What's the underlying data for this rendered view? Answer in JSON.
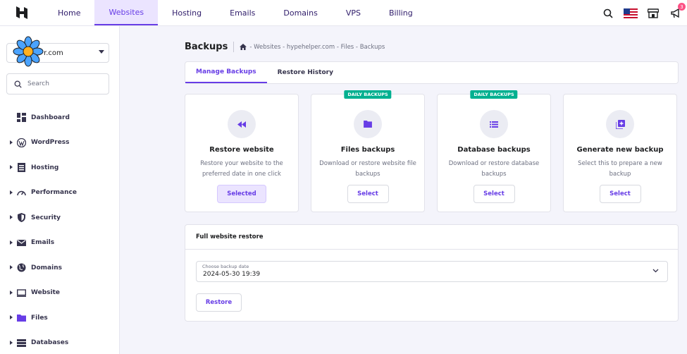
{
  "nav": {
    "items": [
      {
        "label": "Home",
        "active": false
      },
      {
        "label": "Websites",
        "active": true
      },
      {
        "label": "Hosting",
        "active": false
      },
      {
        "label": "Emails",
        "active": false
      },
      {
        "label": "Domains",
        "active": false
      },
      {
        "label": "VPS",
        "active": false
      },
      {
        "label": "Billing",
        "active": false
      }
    ],
    "notification_count": "3"
  },
  "sidebar": {
    "site_value": "r.com",
    "search_placeholder": "Search",
    "items": [
      {
        "label": "Dashboard",
        "icon": "dashboard-icon"
      },
      {
        "label": "WordPress",
        "icon": "wordpress-icon"
      },
      {
        "label": "Hosting",
        "icon": "hosting-icon"
      },
      {
        "label": "Performance",
        "icon": "gauge-icon"
      },
      {
        "label": "Security",
        "icon": "shield-icon"
      },
      {
        "label": "Emails",
        "icon": "mail-icon"
      },
      {
        "label": "Domains",
        "icon": "globe-icon"
      },
      {
        "label": "Website",
        "icon": "monitor-icon"
      },
      {
        "label": "Files",
        "icon": "folder-icon"
      },
      {
        "label": "Databases",
        "icon": "database-icon"
      }
    ]
  },
  "header": {
    "title": "Backups",
    "breadcrumb": "- Websites - hypehelper.com - Files - Backups"
  },
  "tabs": [
    {
      "label": "Manage Backups",
      "active": true
    },
    {
      "label": "Restore History",
      "active": false
    }
  ],
  "cards": [
    {
      "ribbon": "",
      "title": "Restore website",
      "desc": "Restore your website to the preferred date in one click",
      "button": "Selected",
      "icon": "rewind-icon"
    },
    {
      "ribbon": "DAILY BACKUPS",
      "title": "Files backups",
      "desc": "Download or restore website file backups",
      "button": "Select",
      "icon": "folder-icon"
    },
    {
      "ribbon": "DAILY BACKUPS",
      "title": "Database backups",
      "desc": "Download or restore database backups",
      "button": "Select",
      "icon": "list-icon"
    },
    {
      "ribbon": "",
      "title": "Generate new backup",
      "desc": "Select this to prepare a new backup",
      "button": "Select",
      "icon": "add-box-icon"
    }
  ],
  "panel": {
    "title": "Full website restore",
    "date_label": "Choose backup date",
    "date_value": "2024-05-30 19:39",
    "restore_label": "Restore"
  },
  "colors": {
    "accent": "#673de6",
    "accent_light": "#ebe4ff",
    "ribbon": "#00b090"
  }
}
